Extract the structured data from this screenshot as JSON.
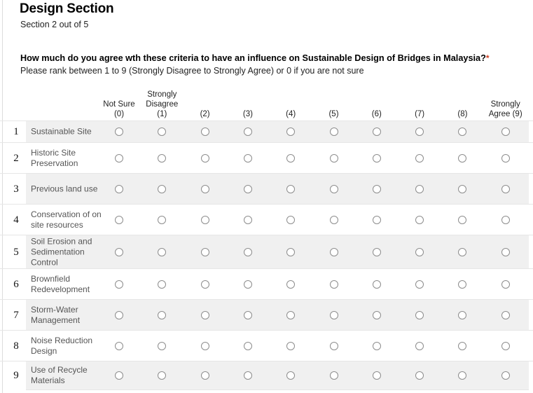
{
  "header": {
    "title": "Design Section",
    "subtitle": "Section 2 out of 5"
  },
  "question": {
    "text": "How much do you agree wth these criteria to have an influence on Sustainable Design of Bridges in Malaysia?",
    "required_marker": "*",
    "help": "Please rank between 1 to 9 (Strongly Disagree to Strongly Agree) or 0 if you are not sure"
  },
  "matrix": {
    "columns": [
      {
        "line1": "Not Sure",
        "line2": "(0)",
        "value": "0"
      },
      {
        "line1": "Strongly",
        "line2": "Disagree",
        "line3": "(1)",
        "value": "1"
      },
      {
        "line1": "(2)",
        "value": "2"
      },
      {
        "line1": "(3)",
        "value": "3"
      },
      {
        "line1": "(4)",
        "value": "4"
      },
      {
        "line1": "(5)",
        "value": "5"
      },
      {
        "line1": "(6)",
        "value": "6"
      },
      {
        "line1": "(7)",
        "value": "7"
      },
      {
        "line1": "(8)",
        "value": "8"
      },
      {
        "line1": "Strongly",
        "line2": "Agree (9)",
        "value": "9"
      }
    ],
    "rows": [
      {
        "num": "1",
        "label": "Sustainable Site",
        "selected": null
      },
      {
        "num": "2",
        "label": "Historic Site Preservation",
        "selected": null
      },
      {
        "num": "3",
        "label": "Previous land use",
        "selected": null
      },
      {
        "num": "4",
        "label": "Conservation of on site resources",
        "selected": null
      },
      {
        "num": "5",
        "label": "Soil Erosion and Sedimentation Control",
        "selected": null
      },
      {
        "num": "6",
        "label": "Brownfield Redevelopment",
        "selected": null
      },
      {
        "num": "7",
        "label": "Storm-Water Management",
        "selected": null
      },
      {
        "num": "8",
        "label": "Noise Reduction Design",
        "selected": null
      },
      {
        "num": "9",
        "label": "Use of Recycle Materials",
        "selected": null
      }
    ]
  },
  "colors": {
    "stripe": "#f0f0f0",
    "radio_border": "#8d8d8d",
    "label_text": "#555555",
    "required": "#cc4125"
  }
}
